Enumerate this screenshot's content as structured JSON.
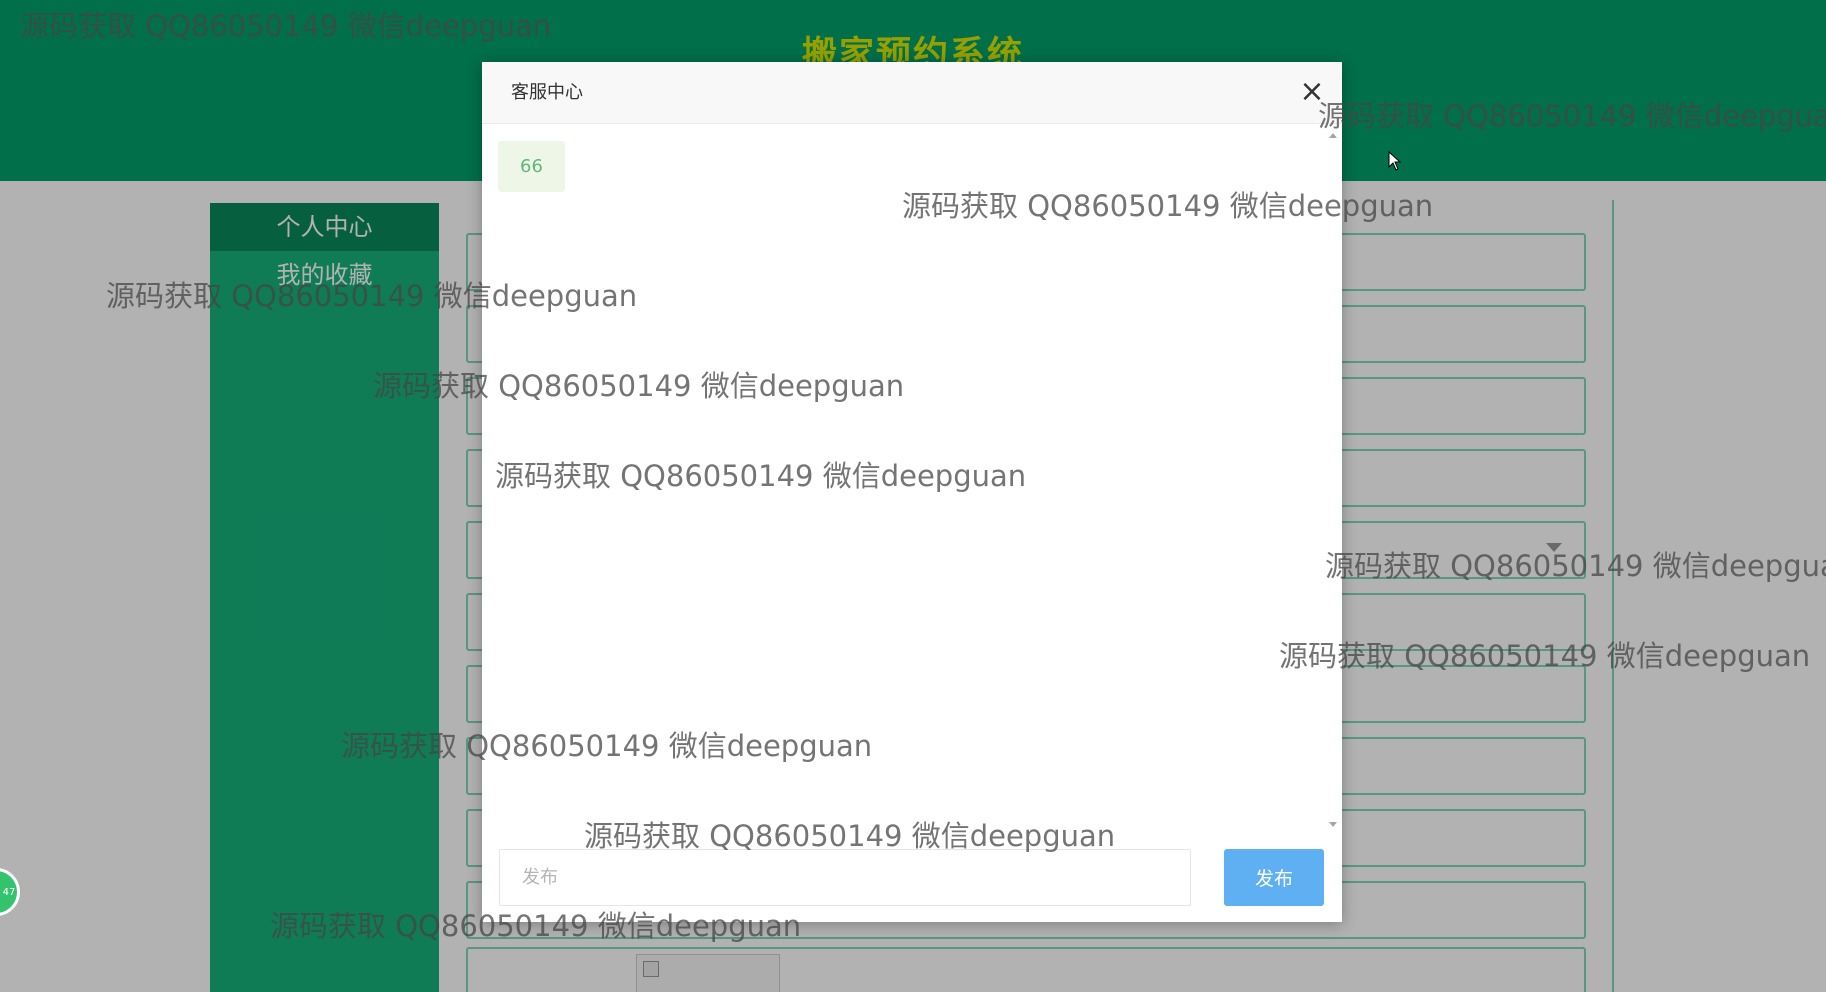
{
  "app": {
    "title": "搬家预约系统"
  },
  "sidebar": {
    "items": [
      {
        "label": "个人中心",
        "active": true
      },
      {
        "label": "我的收藏",
        "active": false
      }
    ]
  },
  "modal": {
    "title": "客服中心",
    "close_symbol": "×",
    "messages": [
      {
        "text": "66"
      }
    ],
    "input_placeholder": "发布",
    "send_label": "发布"
  },
  "float_badge": {
    "text": "47"
  },
  "watermark": {
    "text": "源码获取 QQ86050149 微信deepguan"
  },
  "colors": {
    "header_green": "#00a06b",
    "sidebar_green": "#16b27c",
    "sidebar_active": "#0a8a5c",
    "title_yellow": "#d8e600",
    "send_button_blue": "#5fb0f2",
    "message_bubble_bg": "#eef6e7",
    "message_text_green": "#5fb878"
  },
  "icons": {
    "close": "close-icon",
    "cursor": "mouse-cursor-icon",
    "dropdown": "chevron-down-icon"
  }
}
